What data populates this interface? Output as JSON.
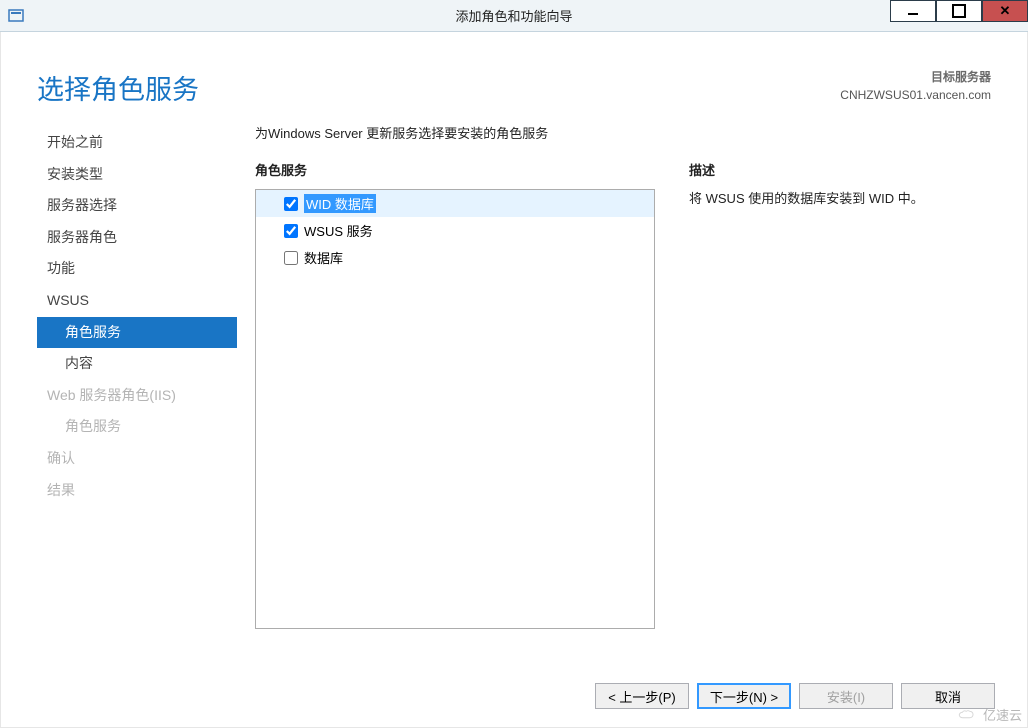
{
  "window": {
    "title": "添加角色和功能向导"
  },
  "header": {
    "page_title": "选择角色服务",
    "target_label": "目标服务器",
    "target_value": "CNHZWSUS01.vancen.com"
  },
  "sidebar": {
    "items": [
      {
        "label": "开始之前",
        "indent": 0,
        "selected": false,
        "disabled": false
      },
      {
        "label": "安装类型",
        "indent": 0,
        "selected": false,
        "disabled": false
      },
      {
        "label": "服务器选择",
        "indent": 0,
        "selected": false,
        "disabled": false
      },
      {
        "label": "服务器角色",
        "indent": 0,
        "selected": false,
        "disabled": false
      },
      {
        "label": "功能",
        "indent": 0,
        "selected": false,
        "disabled": false
      },
      {
        "label": "WSUS",
        "indent": 0,
        "selected": false,
        "disabled": false
      },
      {
        "label": "角色服务",
        "indent": 1,
        "selected": true,
        "disabled": false
      },
      {
        "label": "内容",
        "indent": 1,
        "selected": false,
        "disabled": false
      },
      {
        "label": "Web 服务器角色(IIS)",
        "indent": 0,
        "selected": false,
        "disabled": true
      },
      {
        "label": "角色服务",
        "indent": 1,
        "selected": false,
        "disabled": true
      },
      {
        "label": "确认",
        "indent": 0,
        "selected": false,
        "disabled": true
      },
      {
        "label": "结果",
        "indent": 0,
        "selected": false,
        "disabled": true
      }
    ]
  },
  "main": {
    "instruction": "为Windows Server 更新服务选择要安装的角色服务",
    "roles_label": "角色服务",
    "roles": [
      {
        "label": "WID 数据库",
        "checked": true,
        "highlighted": true
      },
      {
        "label": "WSUS 服务",
        "checked": true,
        "highlighted": false
      },
      {
        "label": "数据库",
        "checked": false,
        "highlighted": false
      }
    ],
    "desc_label": "描述",
    "desc_text": "将 WSUS 使用的数据库安装到 WID 中。"
  },
  "buttons": {
    "prev": "< 上一步(P)",
    "next": "下一步(N) >",
    "install": "安装(I)",
    "cancel": "取消"
  },
  "watermark": "亿速云"
}
